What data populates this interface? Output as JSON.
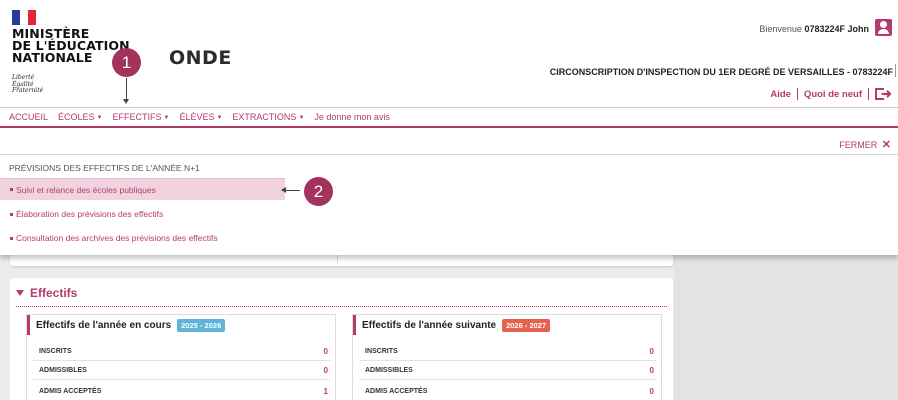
{
  "header": {
    "ministry_line1": "MINISTÈRE",
    "ministry_line2": "DE L'ÉDUCATION",
    "ministry_line3": "NATIONALE",
    "motto_1": "Liberté",
    "motto_2": "Égalité",
    "motto_3": "Fraternité",
    "app_title": "ONDE",
    "welcome_prefix": "Bienvenue",
    "welcome_user": "0783224F John",
    "circonscription": "CIRCONSCRIPTION D'INSPECTION DU 1ER DEGRÉ DE VERSAILLES - 0783224F",
    "help_link": "Aide",
    "news_link": "Quoi de neuf"
  },
  "steps": {
    "step1": "1",
    "step2": "2"
  },
  "nav": {
    "items": [
      {
        "label": "ACCUEIL",
        "caret": ""
      },
      {
        "label": "ÉCOLES",
        "caret": "▼"
      },
      {
        "label": "EFFECTIFS",
        "caret": "▼"
      },
      {
        "label": "ÉLÈVES",
        "caret": "▼"
      },
      {
        "label": "EXTRACTIONS",
        "caret": "▼"
      },
      {
        "label": "Je donne mon avis",
        "caret": ""
      }
    ]
  },
  "panel": {
    "close_label": "FERMER",
    "close_icon": "✕",
    "title": "PRÉVISIONS DES EFFECTIFS DE L'ANNÉE N+1",
    "links": [
      "Suivi et relance des écoles publiques",
      "Élaboration des prévisions des effectifs",
      "Consultation des archives des prévisions des effectifs"
    ]
  },
  "section": {
    "title": "Effectifs",
    "cards": [
      {
        "title": "Effectifs de l'année en cours",
        "tag": "2025 - 2026",
        "rows": [
          {
            "label": "INSCRITS",
            "value": "0"
          },
          {
            "label": "ADMISSIBLES",
            "value": "0"
          },
          {
            "label": "ADMIS ACCEPTÉS",
            "value": "1"
          }
        ]
      },
      {
        "title": "Effectifs de l'année suivante",
        "tag": "2026 - 2027",
        "rows": [
          {
            "label": "INSCRITS",
            "value": "0"
          },
          {
            "label": "ADMISSIBLES",
            "value": "0"
          },
          {
            "label": "ADMIS ACCEPTÉS",
            "value": "0"
          }
        ]
      }
    ]
  },
  "colors": {
    "accent": "#b53a6e",
    "badge": "#a3325d",
    "highlight": "#f1d3df",
    "tag_current": "#5fb4d8",
    "tag_next": "#e5624f"
  }
}
